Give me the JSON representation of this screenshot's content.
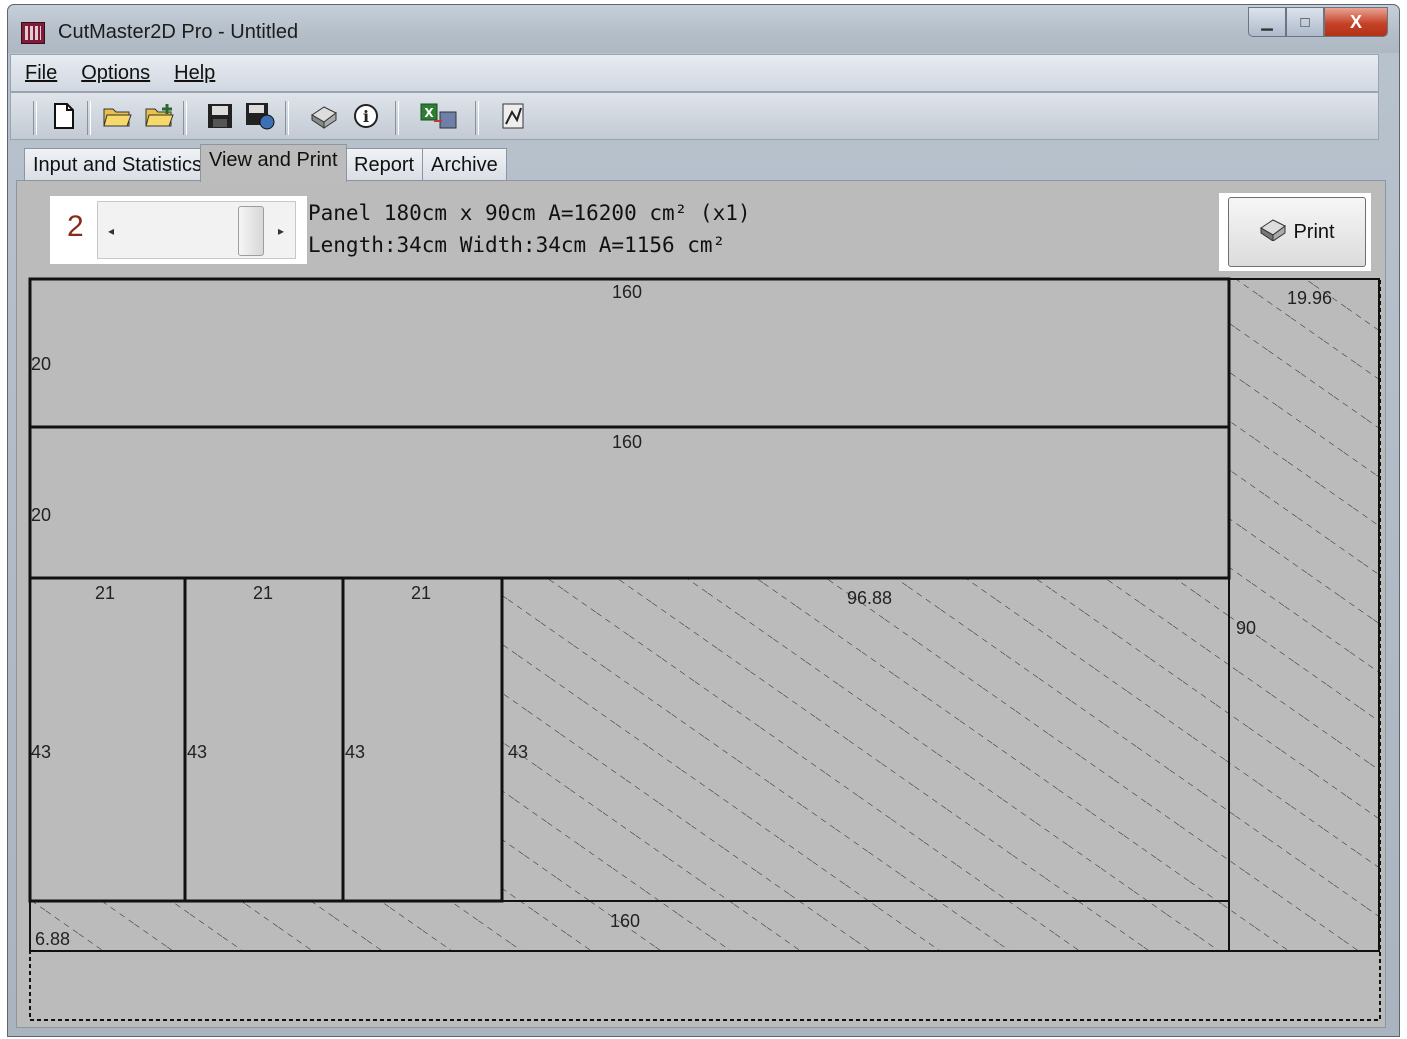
{
  "window": {
    "title": "CutMaster2D Pro - Untitled",
    "minimize_glyph": "▁",
    "maximize_glyph": "□",
    "close_glyph": "X"
  },
  "menu": {
    "file": "File",
    "options": "Options",
    "help": "Help"
  },
  "toolbar": {
    "icons": [
      "new-file-icon",
      "open-folder-icon",
      "open-add-icon",
      "save-icon",
      "save-as-icon",
      "print-icon",
      "info-icon",
      "export-excel-icon",
      "chart-icon"
    ]
  },
  "tabs": {
    "input": "Input and Statistics",
    "view": "View and Print",
    "report": "Report",
    "archive": "Archive"
  },
  "view": {
    "page_number": "2",
    "panel_info": "Panel 180cm x 90cm A=16200 cm² (x1)",
    "piece_info": "Length:34cm Width:34cm A=1156 cm²",
    "print_label": "Print"
  },
  "layout": {
    "labels": {
      "row1_width": "160",
      "row1_height": "20",
      "row2_width": "160",
      "row2_height": "20",
      "p1_width": "21",
      "p1_height": "43",
      "p2_width": "21",
      "p2_height": "43",
      "p3_width": "21",
      "p3_height": "43",
      "waste_mid_width": "96.88",
      "waste_mid_height": "43",
      "waste_bottom_width": "160",
      "waste_bottom_height": "6.88",
      "waste_right_width": "19.96",
      "waste_right_height": "90"
    }
  }
}
